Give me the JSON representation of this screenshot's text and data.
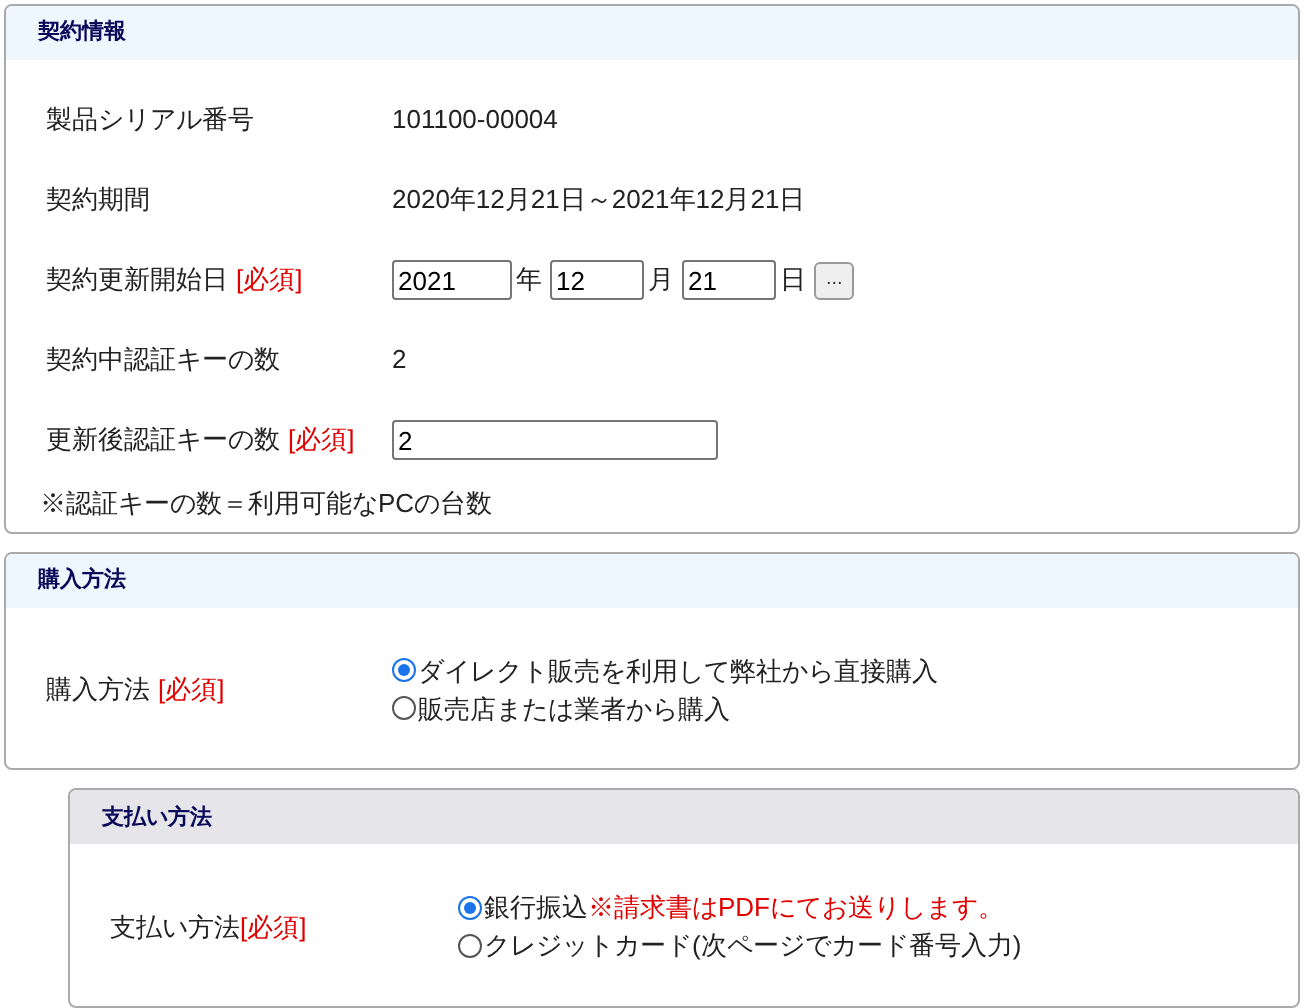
{
  "sections": [
    {
      "kind": "group",
      "title": "契約情報",
      "fields": [
        {
          "kind": "text",
          "label": "製品シリアル番号",
          "value": "101100-00004"
        },
        {
          "kind": "text",
          "label": "契約期間",
          "value": "2020年12月21日～2021年12月21日"
        },
        {
          "kind": "date",
          "label": "契約更新開始日",
          "required_mark": "[必須]",
          "year": "2021",
          "year_unit": "年",
          "month": "12",
          "month_unit": "月",
          "day": "21",
          "day_unit": "日",
          "picker": "..."
        },
        {
          "kind": "text",
          "label": "契約中認証キーの数",
          "value": "2"
        },
        {
          "kind": "input",
          "label": "更新後認証キーの数",
          "required_mark": "[必須]",
          "value": "2"
        }
      ],
      "note": "※認証キーの数＝利用可能なPCの台数"
    },
    {
      "kind": "group",
      "title": "購入方法",
      "fields": [
        {
          "kind": "radio",
          "label": "購入方法",
          "required_mark": "[必須]",
          "options": [
            {
              "label": "ダイレクト販売を利用して弊社から直接購入",
              "selected": true
            },
            {
              "label": "販売店または業者から購入",
              "selected": false
            }
          ]
        }
      ]
    },
    {
      "kind": "subgroup",
      "title": "支払い方法",
      "fields": [
        {
          "kind": "radio",
          "label": "支払い方法",
          "required_mark": "[必須]",
          "options": [
            {
              "label": "銀行振込",
              "note": "※請求書はPDFにてお送りします。",
              "selected": true
            },
            {
              "label": "クレジットカード(次ページでカード番号入力)",
              "selected": false
            }
          ]
        }
      ]
    }
  ]
}
